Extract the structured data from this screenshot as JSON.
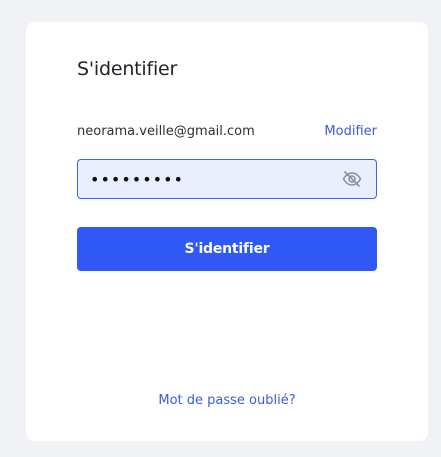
{
  "login": {
    "title": "S'identifier",
    "email": "neorama.veille@gmail.com",
    "modify_label": "Modifier",
    "password_value": "123456789",
    "submit_label": "S'identifier",
    "forgot_label": "Mot de passe oublié?"
  },
  "icons": {
    "visibility": "eye-slash-icon"
  },
  "colors": {
    "accent": "#2f58f5",
    "link": "#3b5bdb",
    "field_bg": "#e9effd",
    "field_border": "#3366ff"
  }
}
